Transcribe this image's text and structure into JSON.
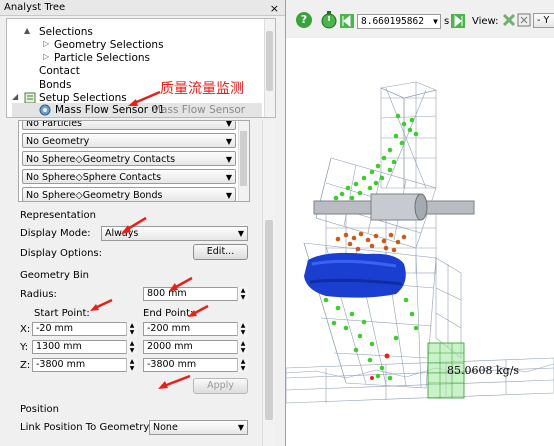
{
  "panel": {
    "title": "Analyst Tree",
    "close": "×"
  },
  "tree": [
    {
      "label": "Selections",
      "toggle": "▲"
    },
    {
      "label": "Geometry Selections",
      "toggle": "▷"
    },
    {
      "label": "Particle Selections",
      "toggle": "▷"
    },
    {
      "label": "Contact"
    },
    {
      "label": "Bonds"
    },
    {
      "label": "Setup Selections",
      "toggle": "◢"
    },
    {
      "label": "Mass Flow Sensor 01",
      "sublabel": "Mass Flow Sensor"
    }
  ],
  "annotation": {
    "text": "质量流量监测",
    "color": "#e8201a"
  },
  "contact_list": [
    "No Particles",
    "No Geometry",
    "No Sphere◇Geometry Contacts",
    "No Sphere◇Sphere Contacts",
    "No Sphere◇Geometry Bonds"
  ],
  "representation": {
    "heading": "Representation",
    "display_mode_label": "Display Mode:",
    "display_mode": "Always",
    "display_options_label": "Display Options:",
    "edit_button": "Edit..."
  },
  "geometry_bin": {
    "heading": "Geometry Bin",
    "radius_label": "Radius:",
    "radius": "800 mm",
    "start_heading": "Start Point:",
    "end_heading": "End Point:",
    "x_label": "X:",
    "y_label": "Y:",
    "z_label": "Z:",
    "start": {
      "x": "-20 mm",
      "y": "1300 mm",
      "z": "-3800 mm"
    },
    "end": {
      "x": "-200 mm",
      "y": "2000 mm",
      "z": "-3800 mm"
    },
    "apply_button": "Apply"
  },
  "position": {
    "heading": "Position",
    "link_label": "Link Position To Geometry:",
    "link_value": "None"
  },
  "toolbar": {
    "help": "?",
    "time": "8.660195862",
    "time_unit": "s",
    "view_label": "View:",
    "view_dropdown": "- Y"
  },
  "viewport": {
    "mass_flow_readout": "85.0608 kg/s"
  },
  "colors": {
    "accent_red": "#e8201a",
    "particle_blue": "#1a3fd0",
    "particle_green": "#3ecb2e",
    "particle_orange": "#c85a1e",
    "wireframe": "#8f9fb4"
  }
}
